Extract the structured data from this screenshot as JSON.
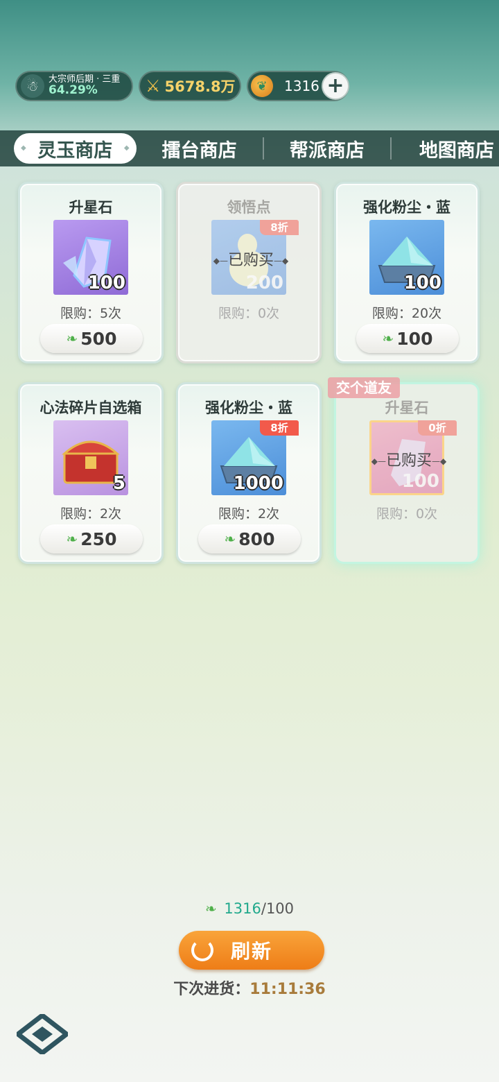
{
  "status": {
    "rank_title": "大宗师后期 · 三重",
    "rank_percent": "64.29%",
    "power": "5678.8万",
    "jade": "1316"
  },
  "tabs": [
    {
      "label": "灵玉商店",
      "active": true
    },
    {
      "label": "擂台商店",
      "active": false
    },
    {
      "label": "帮派商店",
      "active": false
    },
    {
      "label": "地图商店",
      "active": false
    }
  ],
  "items": [
    {
      "name": "升星石",
      "qty": "100",
      "limit": "限购：5次",
      "price": "500",
      "icon": "crystal-icon"
    },
    {
      "name": "领悟点",
      "qty": "200",
      "limit": "限购：0次",
      "discount": "8折",
      "status": "已购买",
      "icon": "gourd-icon"
    },
    {
      "name": "强化粉尘・蓝",
      "qty": "100",
      "limit": "限购：20次",
      "price": "100",
      "icon": "dust-icon"
    },
    {
      "name": "心法碎片自选箱",
      "qty": "5",
      "limit": "限购：2次",
      "price": "250",
      "icon": "chest-icon"
    },
    {
      "name": "强化粉尘・蓝",
      "qty": "1000",
      "limit": "限购：2次",
      "discount": "8折",
      "price": "800",
      "icon": "dust-icon"
    },
    {
      "name": "升星石",
      "qty": "100",
      "limit": "限购：0次",
      "discount": "0折",
      "status": "已购买",
      "tag": "交个道友",
      "icon": "crystal-icon"
    }
  ],
  "footer": {
    "balance_current": "1316",
    "balance_separator": "/",
    "balance_total": "100",
    "refresh_label": "刷新",
    "restock_label": "下次进货：",
    "restock_time": "11:11:36"
  },
  "colors": {
    "accent_orange": "#ee7d17",
    "discount_red": "#f25a4b",
    "tab_bar": "#284842",
    "balance_green": "#21a98c"
  }
}
